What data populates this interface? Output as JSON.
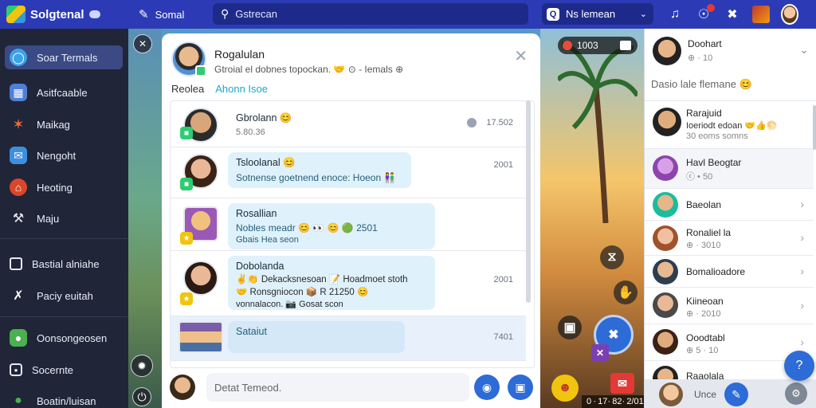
{
  "topbar": {
    "brand": "Solgtenal",
    "nav_label": "Somal",
    "search_placeholder": "Gstrecan",
    "select_value": "Ns lemean",
    "select_badge": "Q"
  },
  "sidebar": {
    "items": [
      {
        "label": "Soar Termals",
        "icon": "chat-icon",
        "active": true
      },
      {
        "label": "Asitfcaable",
        "icon": "grid-icon"
      },
      {
        "label": "Maikag",
        "icon": "star-icon"
      },
      {
        "label": "Nengoht",
        "icon": "mail-icon"
      },
      {
        "label": "Heoting",
        "icon": "home-icon"
      },
      {
        "label": "Maju",
        "icon": "wrench-icon"
      },
      {
        "label": "Bastial alniahe",
        "icon": "square-icon"
      },
      {
        "label": "Paciy euitah",
        "icon": "tools-icon"
      },
      {
        "label": "Oonsongeosen",
        "icon": "game-icon"
      },
      {
        "label": "Socernte",
        "icon": "record-icon"
      },
      {
        "label": "Boatin/luisan",
        "icon": "people-icon"
      }
    ]
  },
  "chat": {
    "header_name": "Rogalulan",
    "header_sub": "Gtroial el dobnes topockan. 🤝 ⊙ - Iemals ⊕",
    "tabs": [
      "Reolea",
      "Ahonn Isoe"
    ],
    "composer_placeholder": "Detat Temeod.",
    "rows": [
      {
        "title": "Gbrolann 😊",
        "text": "5.80.36",
        "time": "17.502",
        "bubble": false
      },
      {
        "title": "Tsloolanal 😊",
        "text": "Sotnense goetnend enoce: Hoeon 👫",
        "time": "2001",
        "bubble": true
      },
      {
        "title": "Rosallian",
        "text": "Nobles meadr 😊 👀 😊 🟢 2501",
        "text2": "Gbais Hea seon",
        "time": "",
        "bubble": true
      },
      {
        "title": "Dobolanda",
        "text": "✌👏 Dekacksnesoan 📝 Hoadmoet stoth",
        "text2": "🤝 Ronsgniocon 📦 R 21250 😊",
        "text3": "vonnalacon. 📷 Gosat scon",
        "time": "2001",
        "bubble": true
      },
      {
        "title": "Sataiut",
        "text": "",
        "time": "7401",
        "bubble": true,
        "selected": true
      }
    ]
  },
  "scene": {
    "counter_value": "1003",
    "bottom_text": "0 · 17· 82· 2/01"
  },
  "right": {
    "user_name": "Doohart",
    "user_sub": "⊕ · 10",
    "search_label": "Dasio lale flemane 😊",
    "contacts": [
      {
        "name": "Rarajuid",
        "meta": "Ioeriodt edoan 🤝👍🌕",
        "meta2": "30 eoms somns"
      },
      {
        "name": "Havl Beogtar",
        "meta": "ⓒ • 50"
      },
      {
        "name": "Baeolan",
        "meta": ""
      },
      {
        "name": "Ronaliel la",
        "meta": "⊕ · 3010"
      },
      {
        "name": "Bomalioadore",
        "meta": ""
      },
      {
        "name": "Kiineoan",
        "meta": "⊕ · 2010"
      },
      {
        "name": "Ooodtabl",
        "meta": "⊕ 5 · 10"
      },
      {
        "name": "Raaolala",
        "meta": ""
      }
    ],
    "bottom_label": "Unce"
  }
}
